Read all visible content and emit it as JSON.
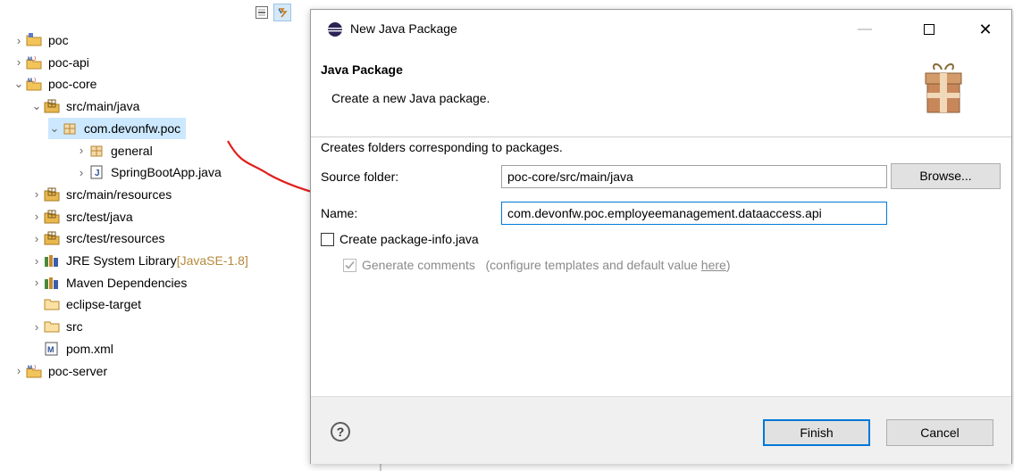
{
  "explorer": {
    "toolbar": {
      "collapse_icon": "collapse-all-icon",
      "link_icon": "link-with-editor-icon"
    },
    "items": [
      {
        "label": "poc",
        "chev": "›",
        "icon": "project-icon"
      },
      {
        "label": "poc-api",
        "chev": "›",
        "icon": "maven-project-icon"
      },
      {
        "label": "poc-core",
        "chev": "⌄",
        "icon": "maven-project-icon"
      },
      {
        "label": "src/main/java",
        "chev": "⌄",
        "icon": "source-folder-icon"
      },
      {
        "label": "com.devonfw.poc",
        "chev": "⌄",
        "icon": "package-icon"
      },
      {
        "label": "general",
        "chev": "›",
        "icon": "package-icon"
      },
      {
        "label": "SpringBootApp.java",
        "chev": "›",
        "icon": "java-file-icon"
      },
      {
        "label": "src/main/resources",
        "chev": "›",
        "icon": "source-folder-icon"
      },
      {
        "label": "src/test/java",
        "chev": "›",
        "icon": "source-folder-icon"
      },
      {
        "label": "src/test/resources",
        "chev": "›",
        "icon": "source-folder-icon"
      },
      {
        "label": "JRE System Library",
        "suffix": "[JavaSE-1.8]",
        "chev": "›",
        "icon": "library-icon"
      },
      {
        "label": "Maven Dependencies",
        "chev": "›",
        "icon": "library-icon"
      },
      {
        "label": "eclipse-target",
        "chev": "",
        "icon": "folder-icon"
      },
      {
        "label": "src",
        "chev": "›",
        "icon": "folder-icon"
      },
      {
        "label": "pom.xml",
        "chev": "",
        "icon": "maven-file-icon"
      },
      {
        "label": "poc-server",
        "chev": "›",
        "icon": "maven-project-icon"
      }
    ]
  },
  "dialog": {
    "title": "New Java Package",
    "minimize": "—",
    "close": "✕",
    "banner_title": "Java Package",
    "banner_subtitle": "Create a new Java package.",
    "description": "Creates folders corresponding to packages.",
    "source_folder_label": "Source folder:",
    "source_folder_value": "poc-core/src/main/java",
    "browse_label": "Browse...",
    "name_label": "Name:",
    "name_value": "com.devonfw.poc.employeemanagement.dataaccess.api",
    "create_package_info_label": "Create package-info.java",
    "create_package_info_checked": false,
    "generate_comments_label": "Generate comments",
    "generate_comments_note": "(configure templates and default value ",
    "generate_comments_link": "here",
    "generate_comments_close": ")",
    "generate_comments_checked": true,
    "help_label": "?",
    "finish_label": "Finish",
    "cancel_label": "Cancel"
  },
  "colors": {
    "accent": "#0078d7",
    "annotation_arrow": "#e0201b",
    "selection": "#cce8ff"
  }
}
